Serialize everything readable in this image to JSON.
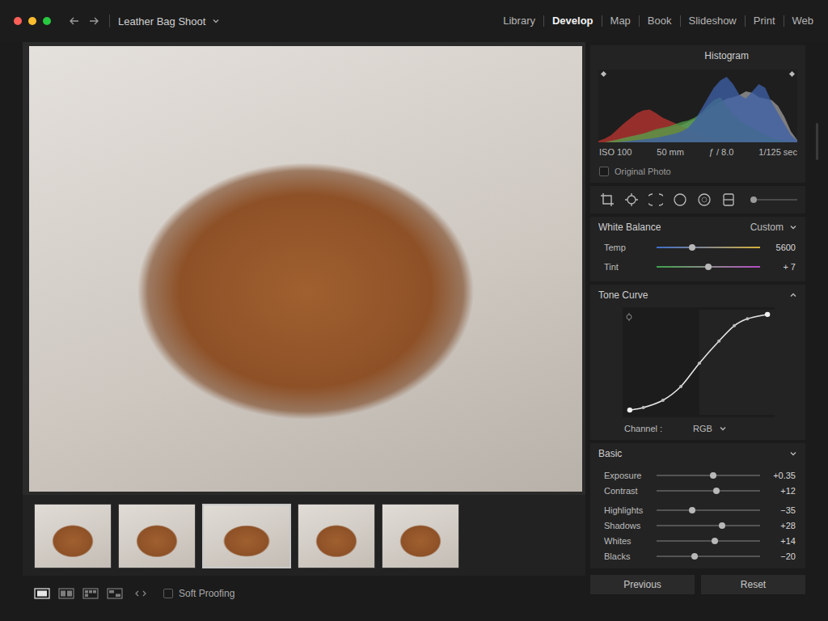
{
  "window": {
    "title": "Leather Bag Shoot"
  },
  "modules": [
    {
      "label": "Library",
      "selected": false
    },
    {
      "label": "Develop",
      "selected": true
    },
    {
      "label": "Map",
      "selected": false
    },
    {
      "label": "Book",
      "selected": false
    },
    {
      "label": "Slideshow",
      "selected": false
    },
    {
      "label": "Print",
      "selected": false
    },
    {
      "label": "Web",
      "selected": false
    }
  ],
  "filmstrip": [
    {
      "selected": false
    },
    {
      "selected": false
    },
    {
      "selected": true
    },
    {
      "selected": false
    },
    {
      "selected": false
    }
  ],
  "toolbar": {
    "views": [
      {
        "selected": true
      },
      {
        "selected": false
      },
      {
        "selected": false
      },
      {
        "selected": false
      }
    ],
    "soft_proofing": {
      "label": "Soft Proofing",
      "checked": false
    }
  },
  "histogram": {
    "title": "Histogram",
    "chevron": "up",
    "series": [
      {
        "color": "#9a9a9a",
        "values": [
          0,
          0,
          0.02,
          0.04,
          0.06,
          0.08,
          0.1,
          0.12,
          0.14,
          0.16,
          0.18,
          0.2,
          0.22,
          0.24,
          0.28,
          0.32,
          0.38,
          0.45,
          0.5,
          0.55,
          0.6,
          0.62,
          0.65,
          0.7,
          0.68,
          0.62,
          0.6,
          0.58,
          0.5,
          0.35,
          0.15,
          0.03
        ]
      },
      {
        "color": "#b8342f",
        "values": [
          0.02,
          0.05,
          0.1,
          0.18,
          0.26,
          0.33,
          0.4,
          0.44,
          0.45,
          0.4,
          0.34,
          0.3,
          0.26,
          0.22,
          0.18,
          0.14,
          0.1,
          0.08,
          0.06,
          0.05,
          0.04,
          0.03,
          0.02,
          0.02,
          0.01,
          0.01,
          0,
          0,
          0,
          0,
          0,
          0
        ]
      },
      {
        "color": "#4f9a45",
        "values": [
          0,
          0,
          0.02,
          0.04,
          0.06,
          0.08,
          0.1,
          0.12,
          0.15,
          0.18,
          0.2,
          0.22,
          0.25,
          0.28,
          0.3,
          0.34,
          0.4,
          0.5,
          0.58,
          0.62,
          0.5,
          0.38,
          0.3,
          0.25,
          0.2,
          0.15,
          0.1,
          0.06,
          0.04,
          0.02,
          0.01,
          0
        ]
      },
      {
        "color": "#3d5fa6",
        "values": [
          0,
          0,
          0,
          0,
          0.01,
          0.02,
          0.03,
          0.04,
          0.05,
          0.06,
          0.08,
          0.1,
          0.12,
          0.15,
          0.2,
          0.3,
          0.45,
          0.6,
          0.75,
          0.85,
          0.9,
          0.8,
          0.65,
          0.6,
          0.7,
          0.8,
          0.75,
          0.55,
          0.4,
          0.25,
          0.1,
          0.02
        ]
      }
    ],
    "exif": [
      "ISO 100",
      "50 mm",
      "ƒ / 8.0",
      "1/125 sec"
    ],
    "original_photo": {
      "label": "Original Photo",
      "checked": false
    }
  },
  "tools": {
    "slider_level": 0
  },
  "white_balance": {
    "title": "White Balance",
    "preset": "Custom",
    "sliders": [
      {
        "label": "Temp",
        "kind": "temp",
        "level": 0.34,
        "value": "5600"
      },
      {
        "label": "Tint",
        "kind": "tint",
        "level": 0.5,
        "value": "+ 7"
      }
    ]
  },
  "tone_curve": {
    "title": "Tone Curve",
    "chevron": "up",
    "points": [
      [
        0.027,
        0.015
      ],
      [
        0.12,
        0.04
      ],
      [
        0.255,
        0.115
      ],
      [
        0.378,
        0.254
      ],
      [
        0.505,
        0.49
      ],
      [
        0.64,
        0.715
      ],
      [
        0.745,
        0.87
      ],
      [
        0.835,
        0.94
      ],
      [
        0.973,
        0.985
      ]
    ],
    "channel_label": "Channel :",
    "channel": "RGB"
  },
  "basic": {
    "title": "Basic",
    "chevron": "down",
    "sliders": [
      {
        "label": "Exposure",
        "kind": "plain",
        "level": 0.55,
        "value": "+0.35"
      },
      {
        "label": "Contrast",
        "kind": "plain",
        "level": 0.58,
        "value": "+12"
      },
      {
        "label": "Highlights",
        "kind": "plain",
        "level": 0.34,
        "value": "−35"
      },
      {
        "label": "Shadows",
        "kind": "plain",
        "level": 0.63,
        "value": "+28"
      },
      {
        "label": "Whites",
        "kind": "plain",
        "level": 0.56,
        "value": "+14"
      },
      {
        "label": "Blacks",
        "kind": "plain",
        "level": 0.37,
        "value": "−20"
      }
    ]
  },
  "buttons": [
    "Previous",
    "Reset"
  ]
}
